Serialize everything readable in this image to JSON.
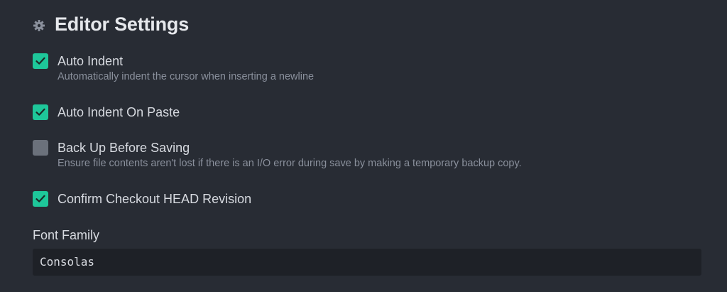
{
  "section": {
    "title": "Editor Settings",
    "icon": "gear-icon"
  },
  "settings": [
    {
      "label": "Auto Indent",
      "description": "Automatically indent the cursor when inserting a newline",
      "checked": true
    },
    {
      "label": "Auto Indent On Paste",
      "description": "",
      "checked": true
    },
    {
      "label": "Back Up Before Saving",
      "description": "Ensure file contents aren't lost if there is an I/O error during save by making a temporary backup copy.",
      "checked": false
    },
    {
      "label": "Confirm Checkout HEAD Revision",
      "description": "",
      "checked": true
    }
  ],
  "font_family": {
    "label": "Font Family",
    "value": "Consolas"
  },
  "colors": {
    "background": "#282c34",
    "accent": "#1ec79a",
    "unchecked": "#6b717b",
    "input_background": "#1e2127"
  }
}
